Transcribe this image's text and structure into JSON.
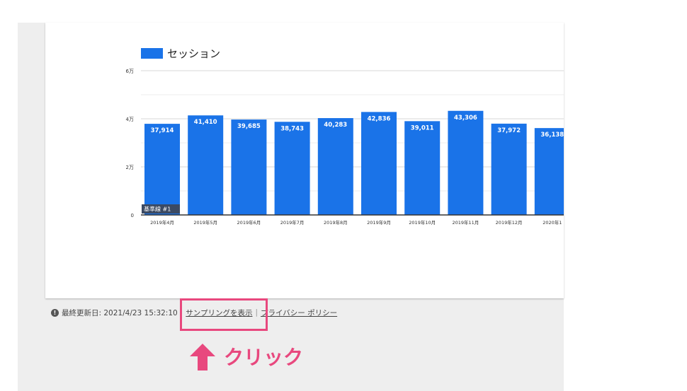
{
  "chart_data": {
    "type": "bar",
    "legend": {
      "label": "セッション",
      "color": "#1a73e8",
      "position": "top-left"
    },
    "categories": [
      "2019年4月",
      "2019年5月",
      "2019年6月",
      "2019年7月",
      "2019年8月",
      "2019年9月",
      "2019年10月",
      "2019年11月",
      "2019年12月",
      "2020年1"
    ],
    "values": [
      37914,
      41410,
      39685,
      38743,
      40283,
      42836,
      39011,
      43306,
      37972,
      36138
    ],
    "value_labels": [
      "37,914",
      "41,410",
      "39,685",
      "38,743",
      "40,283",
      "42,836",
      "39,011",
      "43,306",
      "37,972",
      "36,138"
    ],
    "y_ticks": [
      {
        "value": 0,
        "label": "0"
      },
      {
        "value": 20000,
        "label": "2万"
      },
      {
        "value": 40000,
        "label": "4万"
      },
      {
        "value": 60000,
        "label": "6万"
      }
    ],
    "ylim": [
      0,
      60000
    ],
    "grid": true,
    "baseline_label": "基準線 #1",
    "bar_color": "#1a73e8"
  },
  "footer": {
    "last_updated": "最終更新日: 2021/4/23 15:32:10",
    "sampling_link": "サンプリングを表示",
    "privacy_link": "プライバシー ポリシー",
    "separator": "|",
    "info_glyph": "!"
  },
  "annotation": {
    "click_label": "クリック",
    "color": "#e8487e"
  }
}
